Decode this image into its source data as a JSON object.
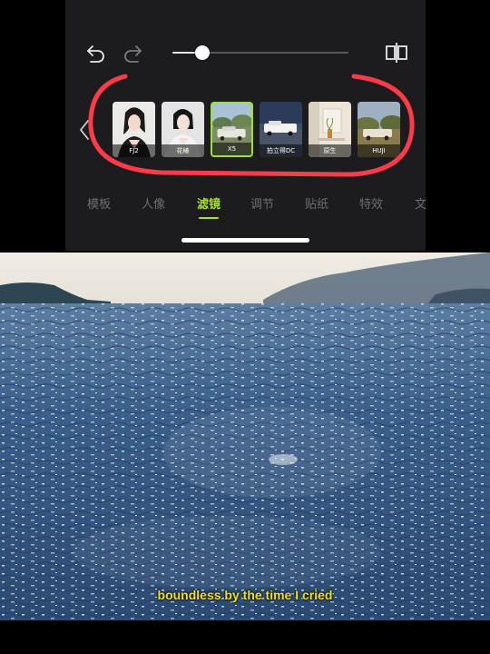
{
  "toolbar": {
    "undo_icon": "undo-icon",
    "redo_icon": "redo-icon",
    "compare_icon": "compare-icon",
    "slider_value": 0.17
  },
  "filters": {
    "back_icon": "chevron-left-icon",
    "items": [
      {
        "label": "FJ2",
        "selected": false
      },
      {
        "label": "花椿",
        "selected": false
      },
      {
        "label": "X5",
        "selected": true
      },
      {
        "label": "拍立得DC",
        "selected": false
      },
      {
        "label": "原生",
        "selected": false
      },
      {
        "label": "HUJI",
        "selected": false
      }
    ]
  },
  "tabs": [
    {
      "label": "模板"
    },
    {
      "label": "人像"
    },
    {
      "label": "滤镜",
      "active": true
    },
    {
      "label": "调节"
    },
    {
      "label": "贴纸"
    },
    {
      "label": "特效"
    },
    {
      "label": "文"
    }
  ],
  "video": {
    "subtitle": "boundless by the time I cried"
  },
  "colors": {
    "accent": "#a6e22e",
    "annotation": "#ff3b4a",
    "subtitle": "#f3e21b",
    "panel_bg": "#1c1c1e"
  }
}
